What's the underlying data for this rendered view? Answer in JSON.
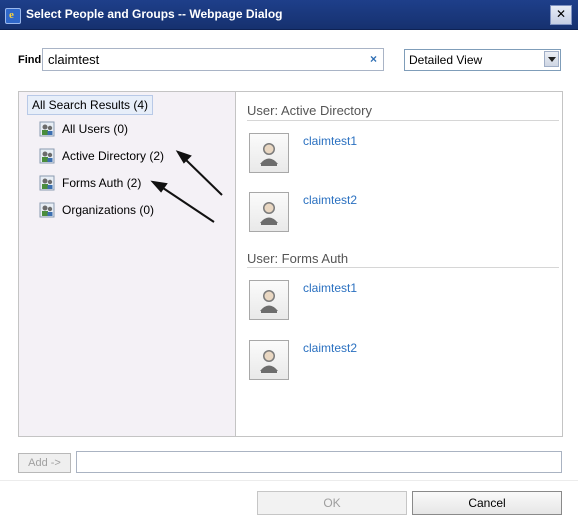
{
  "window": {
    "title": "Select People and Groups -- Webpage Dialog",
    "close_label": "✕"
  },
  "search": {
    "label": "Find",
    "value": "claimtest",
    "clear_label": "×"
  },
  "view": {
    "selected": "Detailed View"
  },
  "tree": {
    "root_label": "All Search Results (4)",
    "items": [
      {
        "label": "All Users (0)"
      },
      {
        "label": "Active Directory (2)"
      },
      {
        "label": "Forms Auth (2)"
      },
      {
        "label": "Organizations (0)"
      }
    ]
  },
  "results": {
    "sections": [
      {
        "heading": "User: Active Directory",
        "users": [
          "claimtest1",
          "claimtest2"
        ]
      },
      {
        "heading": "User: Forms Auth",
        "users": [
          "claimtest1",
          "claimtest2"
        ]
      }
    ]
  },
  "footer": {
    "add_label": "Add ->",
    "ok_label": "OK",
    "cancel_label": "Cancel"
  },
  "colors": {
    "title_bar": "#1e3f8a",
    "link": "#2a70c0",
    "left_pane": "#f4f1f6"
  },
  "icons": [
    "ie-window-icon",
    "close-icon",
    "clear-icon",
    "dropdown-arrow-icon",
    "group-icon",
    "user-avatar-icon",
    "annotation-arrow"
  ]
}
